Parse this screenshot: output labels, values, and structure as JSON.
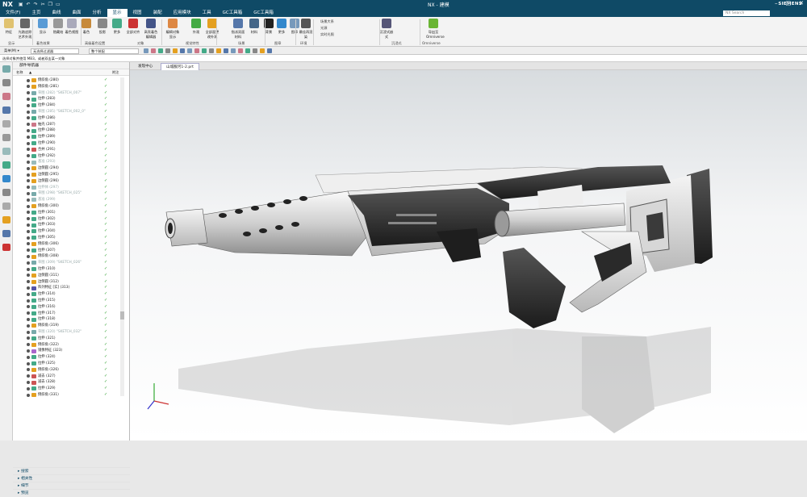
{
  "app": {
    "logo": "NX",
    "title": "NX - 建模",
    "search_placeholder": "NX Search",
    "brand": "SIEMENS"
  },
  "menu": [
    "文件(F)",
    "主页",
    "曲线",
    "曲面",
    "分析",
    "显示",
    "视图",
    "装配",
    "应用模块",
    "工具",
    "GC工具箱",
    "GC工具箱"
  ],
  "ribbon": {
    "buttons": [
      {
        "label": "特征",
        "color": "#e0c270"
      },
      {
        "label": "光路追踪艺术外观",
        "color": "#666"
      },
      {
        "label": "显示",
        "color": "#5a9bd5"
      },
      {
        "label": "隐藏结",
        "color": "#999"
      },
      {
        "label": "着色视图",
        "color": "#aab"
      },
      {
        "label": "着色",
        "color": "#c78a3b"
      },
      {
        "label": "投影",
        "color": "#888"
      },
      {
        "label": "更多",
        "color": "#4a8"
      },
      {
        "label": "全部对齐",
        "color": "#c33"
      },
      {
        "label": "高亮着色编辑器",
        "color": "#458"
      },
      {
        "label": "编辑对象显示",
        "color": "#d84"
      },
      {
        "label": "外观",
        "color": "#4a4"
      },
      {
        "label": "全部面更改外观",
        "color": "#e4a020"
      },
      {
        "label": "指派双面材料",
        "color": "#57a"
      },
      {
        "label": "材料",
        "color": "#468"
      },
      {
        "label": "背景",
        "color": "#222"
      },
      {
        "label": "更多",
        "color": "#38c"
      },
      {
        "label": "图章",
        "color": "#79b"
      },
      {
        "label": "最佳再渲染",
        "color": "#555"
      },
      {
        "label": "沉浸式嵌式",
        "color": "#557"
      },
      {
        "label": "导出至Omniverse",
        "color": "#6ab534"
      }
    ],
    "groups": [
      "显示",
      "着色效果",
      "高级着色设置",
      "对象",
      "视觉特性",
      "场景",
      "图章",
      "环境",
      "沉浸式",
      "Omniverse"
    ],
    "small": [
      "场景大系",
      "光源",
      "实时光照"
    ]
  },
  "toolbar": {
    "menu_label": "菜单(M) ▾",
    "filter": "无选择过滤器",
    "assembly": "整个装配"
  },
  "selection_hint": "选择对象并使用 MB3，或者双击某一对象",
  "nav": {
    "title": "部件导航器",
    "col_name": "名称",
    "col_a": "▲",
    "col_note": "附注"
  },
  "tabs": [
    "发现中心",
    "山城服河1-2.prt"
  ],
  "tree": [
    {
      "label": "倒斜角 (280)",
      "c": "#e4a020"
    },
    {
      "label": "倒斜角 (281)",
      "c": "#e4a020"
    },
    {
      "label": "草图 (282) \"SKETCH_007\"",
      "c": "#7aa",
      "dim": true
    },
    {
      "label": "拉伸 (283)",
      "c": "#4a8"
    },
    {
      "label": "拉伸 (284)",
      "c": "#4a8"
    },
    {
      "label": "草图 (285) \"SKETCH_002_0\"",
      "c": "#7aa",
      "dim": true
    },
    {
      "label": "拉伸 (286)",
      "c": "#4a8"
    },
    {
      "label": "抽壳 (287)",
      "c": "#c78"
    },
    {
      "label": "拉伸 (288)",
      "c": "#4a8"
    },
    {
      "label": "拉伸 (289)",
      "c": "#4a8"
    },
    {
      "label": "拉伸 (290)",
      "c": "#4a8"
    },
    {
      "label": "合并 (291)",
      "c": "#c55"
    },
    {
      "label": "拉伸 (292)",
      "c": "#4a8"
    },
    {
      "label": "基准 (293)",
      "c": "#9bb",
      "dim": true
    },
    {
      "label": "边倒圆 (294)",
      "c": "#e4a020"
    },
    {
      "label": "边倒圆 (295)",
      "c": "#e4a020"
    },
    {
      "label": "边倒圆 (296)",
      "c": "#e4a020"
    },
    {
      "label": "拉伸体 (297)",
      "c": "#9bb",
      "dim": true
    },
    {
      "label": "草图 (298) \"SKETCH_025\"",
      "c": "#7aa",
      "dim": true
    },
    {
      "label": "基准 (299)",
      "c": "#9bb",
      "dim": true
    },
    {
      "label": "倒斜角 (300)",
      "c": "#e4a020"
    },
    {
      "label": "拉伸 (301)",
      "c": "#4a8"
    },
    {
      "label": "拉伸 (302)",
      "c": "#4a8"
    },
    {
      "label": "拉伸 (303)",
      "c": "#4a8"
    },
    {
      "label": "拉伸 (304)",
      "c": "#4a8"
    },
    {
      "label": "拉伸 (305)",
      "c": "#4a8"
    },
    {
      "label": "倒斜角 (306)",
      "c": "#e4a020"
    },
    {
      "label": "拉伸 (307)",
      "c": "#4a8"
    },
    {
      "label": "倒斜角 (308)",
      "c": "#e4a020"
    },
    {
      "label": "草图 (309) \"SKETCH_026\"",
      "c": "#7aa",
      "dim": true
    },
    {
      "label": "拉伸 (310)",
      "c": "#4a8"
    },
    {
      "label": "边倒圆 (311)",
      "c": "#e4a020"
    },
    {
      "label": "边倒圆 (312)",
      "c": "#e4a020"
    },
    {
      "label": "阵列特征 [实] (313)",
      "c": "#55a"
    },
    {
      "label": "拉伸 (314)",
      "c": "#4a8"
    },
    {
      "label": "拉伸 (315)",
      "c": "#4a8"
    },
    {
      "label": "拉伸 (316)",
      "c": "#4a8"
    },
    {
      "label": "拉伸 (317)",
      "c": "#4a8"
    },
    {
      "label": "拉伸 (318)",
      "c": "#4a8"
    },
    {
      "label": "倒斜角 (319)",
      "c": "#e4a020"
    },
    {
      "label": "草图 (320) \"SKETCH_032\"",
      "c": "#7aa",
      "dim": true
    },
    {
      "label": "拉伸 (321)",
      "c": "#4a8"
    },
    {
      "label": "倒斜角 (322)",
      "c": "#e4a020"
    },
    {
      "label": "镜像特征 (323)",
      "c": "#a6c"
    },
    {
      "label": "拉伸 (324)",
      "c": "#4a8"
    },
    {
      "label": "拉伸 (325)",
      "c": "#4a8"
    },
    {
      "label": "倒斜角 (326)",
      "c": "#e4a020"
    },
    {
      "label": "减去 (327)",
      "c": "#c55"
    },
    {
      "label": "减去 (328)",
      "c": "#c55"
    },
    {
      "label": "拉伸 (329)",
      "c": "#4a8"
    },
    {
      "label": "倒斜角 (331)",
      "c": "#e4a020"
    }
  ],
  "panels": [
    "搜索",
    "相关性",
    "细节",
    "预览"
  ]
}
